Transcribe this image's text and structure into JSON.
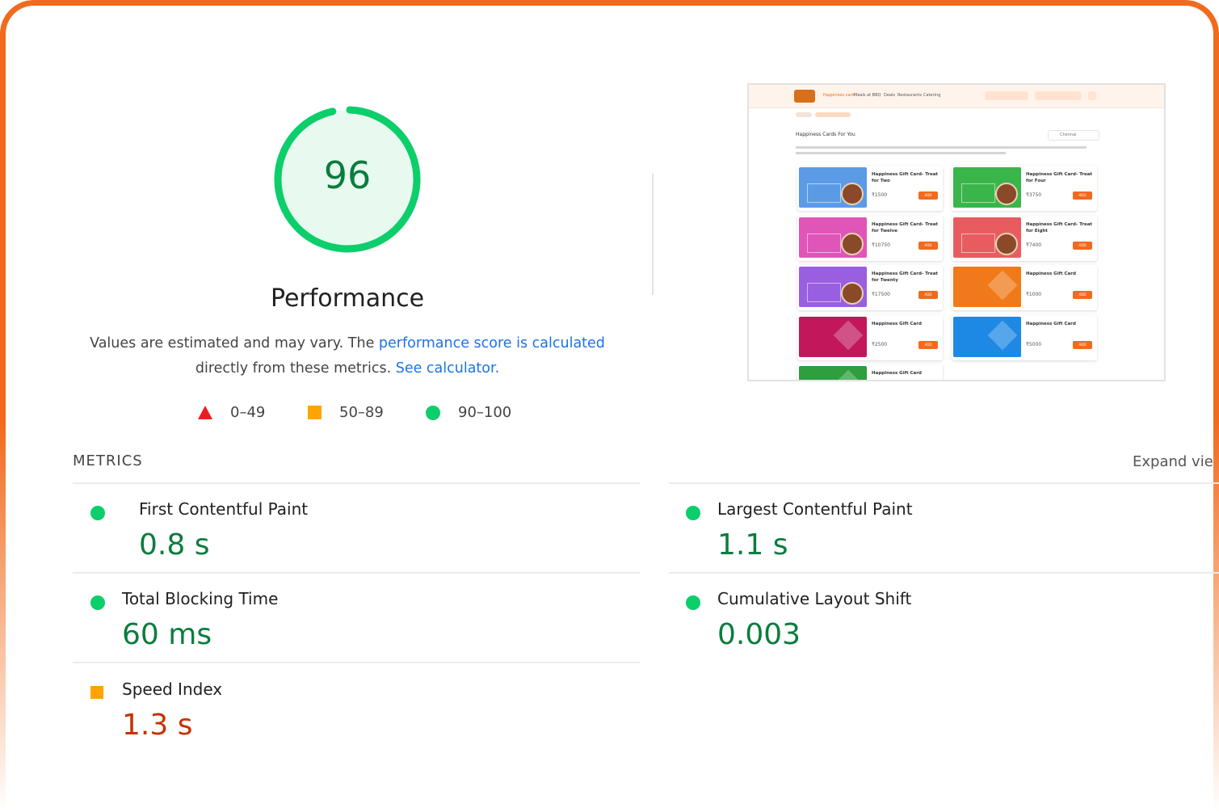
{
  "gauge": {
    "score": "96",
    "color": "#0cce6b",
    "fraction": 0.96
  },
  "performance": {
    "title": "Performance",
    "desc_prefix": "Values are estimated and may vary. The ",
    "desc_link1": "performance score is calculated",
    "desc_mid": "directly from these metrics. ",
    "desc_link2": "See calculator."
  },
  "legend": {
    "fail": "0–49",
    "average": "50–89",
    "pass": "90–100"
  },
  "metrics": {
    "title": "METRICS",
    "expand": "Expand vie",
    "items": [
      {
        "label": "First Contentful Paint",
        "value": "0.8 s",
        "status": "pass"
      },
      {
        "label": "Largest Contentful Paint",
        "value": "1.1 s",
        "status": "pass"
      },
      {
        "label": "Total Blocking Time",
        "value": "60 ms",
        "status": "pass"
      },
      {
        "label": "Cumulative Layout Shift",
        "value": "0.003",
        "status": "pass"
      },
      {
        "label": "Speed Index",
        "value": "1.3 s",
        "status": "average"
      }
    ]
  },
  "thumbnail": {
    "heading": "Happiness Cards For You",
    "city": "Chennai",
    "nav_items": [
      "Happiness card",
      "Meals at BBQ",
      "Deals",
      "Restaurants",
      "Catering"
    ],
    "cards": [
      {
        "title": "Happiness Gift Card- Treat for Two",
        "price": "₹1500",
        "color": "#5b9be6"
      },
      {
        "title": "Happiness Gift Card- Treat for Four",
        "price": "₹3750",
        "color": "#39b54a"
      },
      {
        "title": "Happiness Gift Card- Treat for Twelve",
        "price": "₹10750",
        "color": "#e055b8"
      },
      {
        "title": "Happiness Gift Card- Treat for Eight",
        "price": "₹7400",
        "color": "#e85c60"
      },
      {
        "title": "Happiness Gift Card- Treat for Twenty",
        "price": "₹17500",
        "color": "#9a5ee0"
      },
      {
        "title": "Happiness Gift Card",
        "price": "₹1000",
        "color": "#f07a1a"
      },
      {
        "title": "Happiness Gift Card",
        "price": "₹2500",
        "color": "#c2185b"
      },
      {
        "title": "Happiness Gift Card",
        "price": "₹5000",
        "color": "#1e88e5"
      },
      {
        "title": "Happiness Gift Card",
        "price": "",
        "color": "#2e9e3e"
      }
    ],
    "add_label": "ADD"
  }
}
